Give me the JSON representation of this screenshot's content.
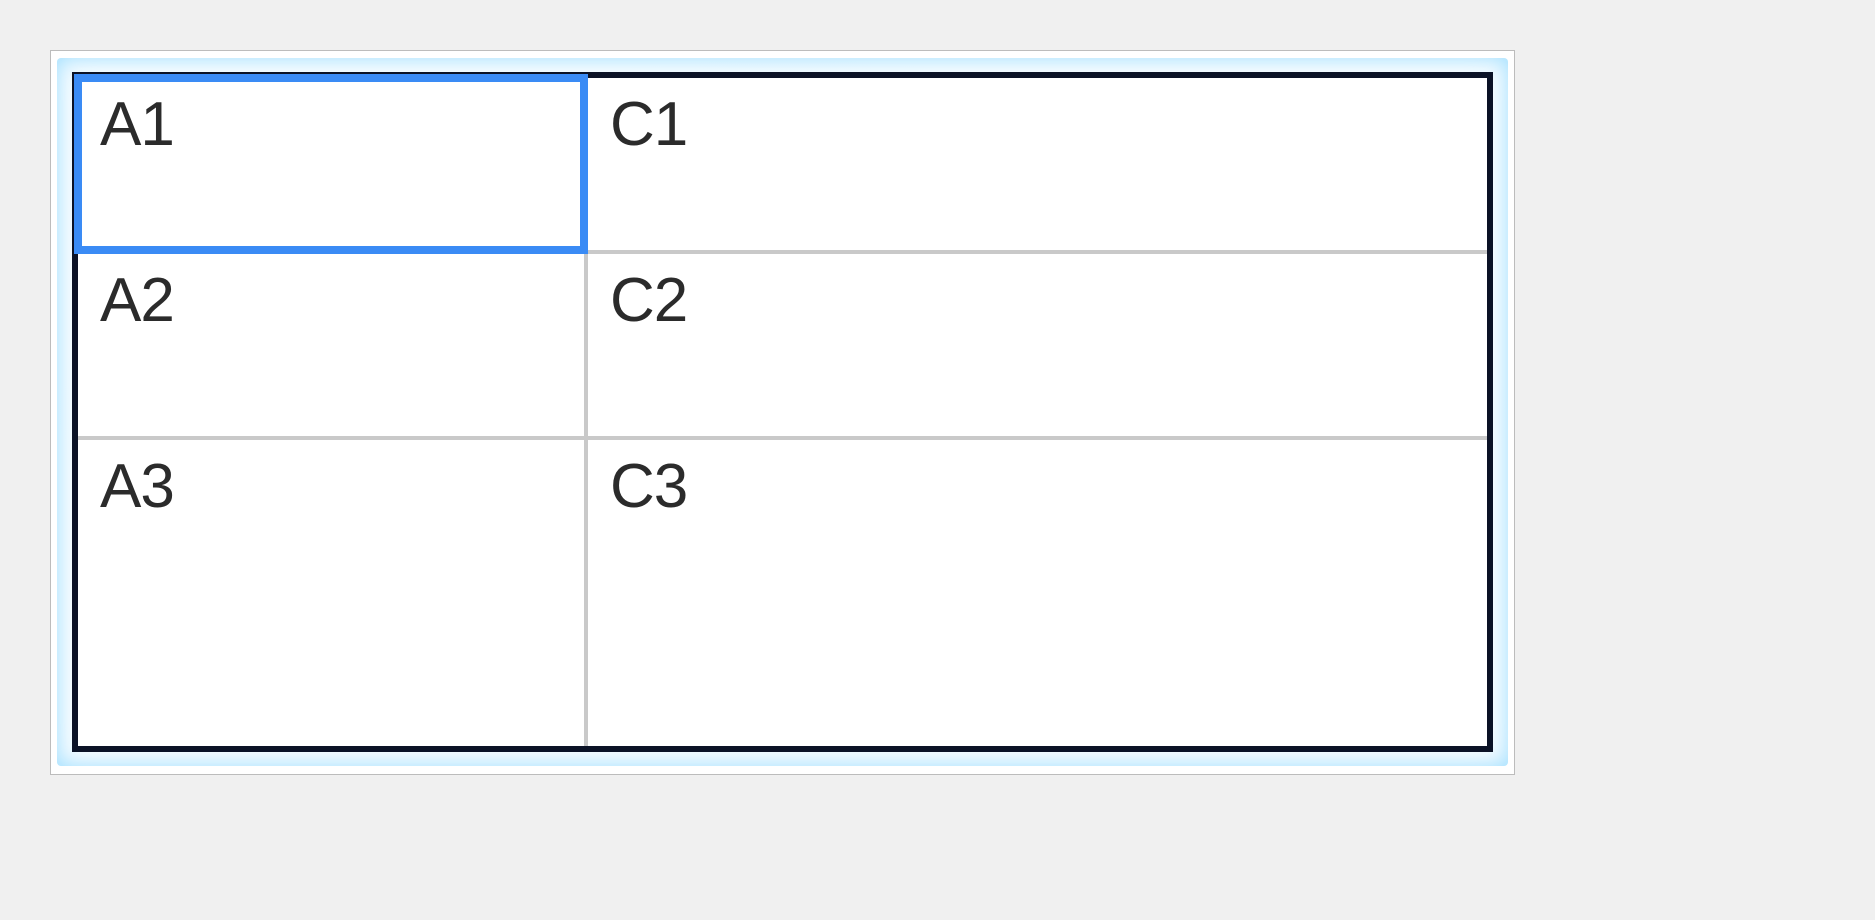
{
  "spreadsheet": {
    "selected": {
      "row": 0,
      "col": 0
    },
    "rows": [
      [
        {
          "value": "A1",
          "selected": true
        },
        {
          "value": "C1",
          "selected": false
        }
      ],
      [
        {
          "value": "A2",
          "selected": false
        },
        {
          "value": "C2",
          "selected": false
        }
      ],
      [
        {
          "value": "A3",
          "selected": false
        },
        {
          "value": "C3",
          "selected": false
        }
      ]
    ]
  },
  "colors": {
    "selection_border": "#3a8bf5",
    "table_border": "#0b1226",
    "grid_line": "#c9c9c9",
    "halo": "#78d2ff"
  }
}
